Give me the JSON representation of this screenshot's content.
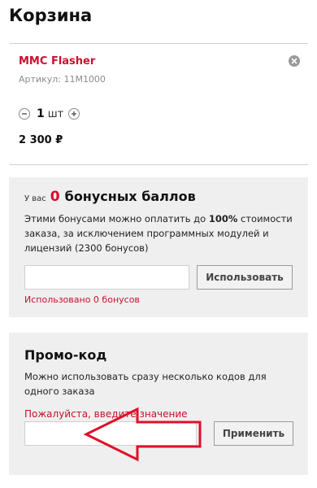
{
  "page": {
    "title": "Корзина"
  },
  "cart_item": {
    "name": "MMC Flasher",
    "sku": "Артикул: 11M1000",
    "quantity": "1",
    "unit": "шт",
    "price": "2 300 ₽",
    "remove_icon": "close-circle-icon"
  },
  "bonus": {
    "prefix": "У вас",
    "count": "0",
    "title": "бонусных баллов",
    "description_pre": "Этими бонусами можно оплатить до ",
    "description_bold": "100%",
    "description_post": " стоимости заказа, за исключением программных модулей и лицензий (2300 бонусов)",
    "input_value": "",
    "button_label": "Использовать",
    "used_text": "Использовано 0 бонусов"
  },
  "promo": {
    "title": "Промо-код",
    "description": "Можно использовать сразу несколько кодов для одного заказа",
    "error": "Пожалуйста, введите значение",
    "input_value": "",
    "button_label": "Применить"
  },
  "colors": {
    "accent_red": "#c8102e",
    "bonus_count_red": "#e0002a",
    "panel_bg": "#efefef",
    "annotation_arrow": "#e0102a"
  }
}
